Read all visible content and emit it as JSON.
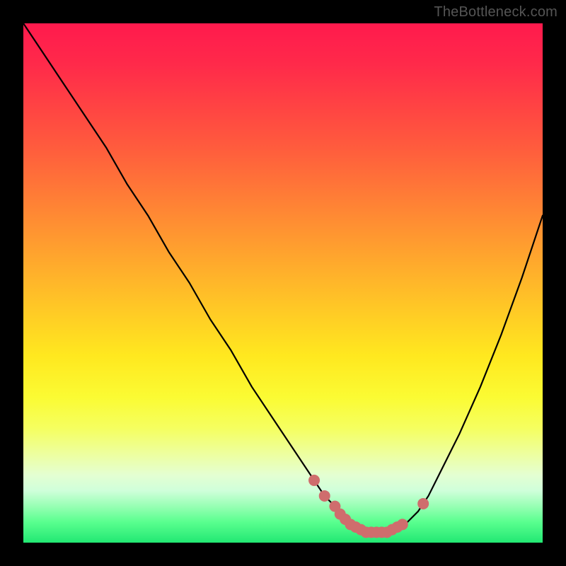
{
  "watermark": "TheBottleneck.com",
  "colors": {
    "frame": "#000000",
    "curve": "#000000",
    "marker_stroke": "#cf6d6d",
    "marker_fill": "#cf6d6d"
  },
  "chart_data": {
    "type": "line",
    "title": "",
    "xlabel": "",
    "ylabel": "",
    "xlim": [
      0,
      100
    ],
    "ylim": [
      0,
      100
    ],
    "grid": false,
    "legend": false,
    "series": [
      {
        "name": "bottleneck-curve",
        "x": [
          0,
          4,
          8,
          12,
          16,
          20,
          24,
          28,
          32,
          36,
          40,
          44,
          48,
          52,
          56,
          58,
          60,
          62,
          64,
          66,
          68,
          70,
          72,
          74,
          76,
          78,
          80,
          84,
          88,
          92,
          96,
          100
        ],
        "y": [
          100,
          94,
          88,
          82,
          76,
          69,
          63,
          56,
          50,
          43,
          37,
          30,
          24,
          18,
          12,
          9,
          7,
          5,
          3,
          2,
          2,
          2,
          3,
          4,
          6,
          9,
          13,
          21,
          30,
          40,
          51,
          63
        ]
      }
    ],
    "markers": [
      {
        "name": "optimal-range-point",
        "x": 56,
        "y": 12
      },
      {
        "name": "optimal-range-point",
        "x": 58,
        "y": 9
      },
      {
        "name": "optimal-range-point",
        "x": 60,
        "y": 7
      },
      {
        "name": "optimal-range-point",
        "x": 61,
        "y": 5.5
      },
      {
        "name": "optimal-range-point",
        "x": 62,
        "y": 4.5
      },
      {
        "name": "optimal-range-point",
        "x": 63,
        "y": 3.5
      },
      {
        "name": "optimal-range-point",
        "x": 64,
        "y": 3
      },
      {
        "name": "optimal-range-point",
        "x": 65,
        "y": 2.5
      },
      {
        "name": "optimal-range-point",
        "x": 66,
        "y": 2
      },
      {
        "name": "optimal-range-point",
        "x": 67,
        "y": 2
      },
      {
        "name": "optimal-range-point",
        "x": 68,
        "y": 2
      },
      {
        "name": "optimal-range-point",
        "x": 69,
        "y": 2
      },
      {
        "name": "optimal-range-point",
        "x": 70,
        "y": 2
      },
      {
        "name": "optimal-range-point",
        "x": 71,
        "y": 2.5
      },
      {
        "name": "optimal-range-point",
        "x": 72,
        "y": 3
      },
      {
        "name": "optimal-range-point",
        "x": 73,
        "y": 3.5
      },
      {
        "name": "optimal-range-point",
        "x": 77,
        "y": 7.5
      }
    ]
  }
}
